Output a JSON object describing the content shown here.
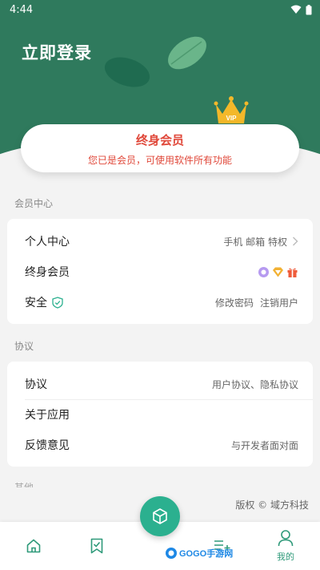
{
  "status_bar": {
    "time": "4:44"
  },
  "header": {
    "login_text": "立即登录",
    "bg_color": "#2f7a5d"
  },
  "vip_card": {
    "title": "终身会员",
    "subtitle": "您已是会员，可使用软件所有功能",
    "accent_color": "#e0483a",
    "badge_text": "VIP"
  },
  "sections": {
    "member": {
      "title": "会员中心",
      "rows": [
        {
          "label": "个人中心",
          "right": "手机 邮箱 特权"
        },
        {
          "label": "终身会员",
          "right": ""
        },
        {
          "label": "安全",
          "right_a": "修改密码",
          "right_b": "注销用户"
        }
      ]
    },
    "agreement": {
      "title": "协议",
      "rows": [
        {
          "label": "协议",
          "right": "用户协议、隐私协议"
        },
        {
          "label": "关于应用",
          "right": ""
        },
        {
          "label": "反馈意见",
          "right": "与开发者面对面"
        }
      ]
    },
    "other": {
      "title": "其他"
    }
  },
  "copyright": "版权 © 域方科技",
  "bottom_nav": {
    "items": [
      {
        "icon": "home-icon"
      },
      {
        "icon": "bookmark-check-icon"
      },
      {
        "icon": "list-add-icon"
      },
      {
        "icon": "person-icon",
        "label": "我的"
      }
    ],
    "fab_icon": "cube-icon",
    "accent_color": "#2bb08f"
  },
  "watermark": {
    "text": "GOGO手游网"
  }
}
